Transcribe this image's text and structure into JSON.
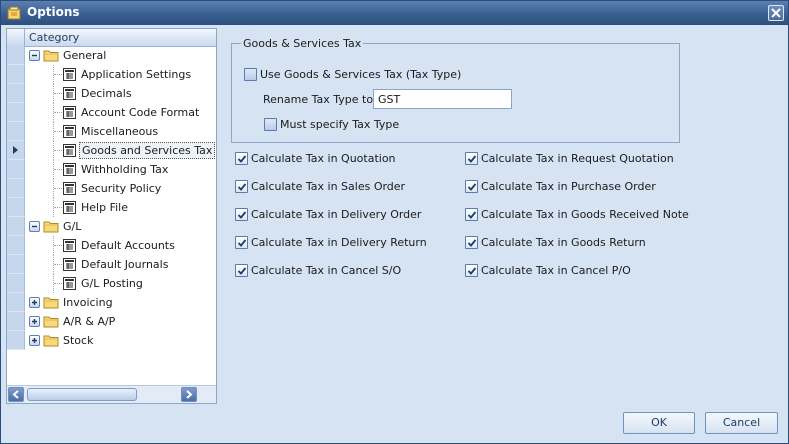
{
  "window": {
    "title": "Options"
  },
  "tree": {
    "header": "Category",
    "nodes": [
      {
        "label": "General",
        "type": "group",
        "expander": "minus"
      },
      {
        "label": "Application Settings",
        "type": "item"
      },
      {
        "label": "Decimals",
        "type": "item"
      },
      {
        "label": "Account Code Format",
        "type": "item"
      },
      {
        "label": "Miscellaneous",
        "type": "item"
      },
      {
        "label": "Goods and Services Tax",
        "type": "item",
        "selected": true
      },
      {
        "label": "Withholding Tax",
        "type": "item"
      },
      {
        "label": "Security Policy",
        "type": "item"
      },
      {
        "label": "Help File",
        "type": "item"
      },
      {
        "label": "G/L",
        "type": "group",
        "expander": "minus"
      },
      {
        "label": "Default Accounts",
        "type": "item"
      },
      {
        "label": "Default Journals",
        "type": "item"
      },
      {
        "label": "G/L Posting",
        "type": "item"
      },
      {
        "label": "Invoicing",
        "type": "group",
        "expander": "plus"
      },
      {
        "label": "A/R & A/P",
        "type": "group",
        "expander": "plus"
      },
      {
        "label": "Stock",
        "type": "group",
        "expander": "plus"
      }
    ]
  },
  "gst": {
    "group_title": "Goods & Services Tax",
    "use_gst": {
      "label": "Use Goods & Services Tax (Tax Type)",
      "checked": false
    },
    "rename_label": "Rename Tax Type to",
    "rename_value": "GST",
    "must_specify": {
      "label": "Must specify Tax Type",
      "checked": false
    }
  },
  "options_left": [
    {
      "label": "Calculate Tax in Quotation",
      "checked": true
    },
    {
      "label": "Calculate Tax in Sales Order",
      "checked": true
    },
    {
      "label": "Calculate Tax in Delivery Order",
      "checked": true
    },
    {
      "label": "Calculate Tax in Delivery Return",
      "checked": true
    },
    {
      "label": "Calculate Tax in Cancel S/O",
      "checked": true
    }
  ],
  "options_right": [
    {
      "label": "Calculate Tax in Request Quotation",
      "checked": true
    },
    {
      "label": "Calculate Tax in Purchase Order",
      "checked": true
    },
    {
      "label": "Calculate Tax in Goods Received Note",
      "checked": true
    },
    {
      "label": "Calculate Tax in Goods Return",
      "checked": true
    },
    {
      "label": "Calculate Tax in Cancel P/O",
      "checked": true
    }
  ],
  "buttons": {
    "ok": "OK",
    "cancel": "Cancel"
  },
  "colors": {
    "title_bar": "#3a5f92",
    "dialog_bg": "#d5e3f3",
    "accent": "#5a7ab0"
  }
}
